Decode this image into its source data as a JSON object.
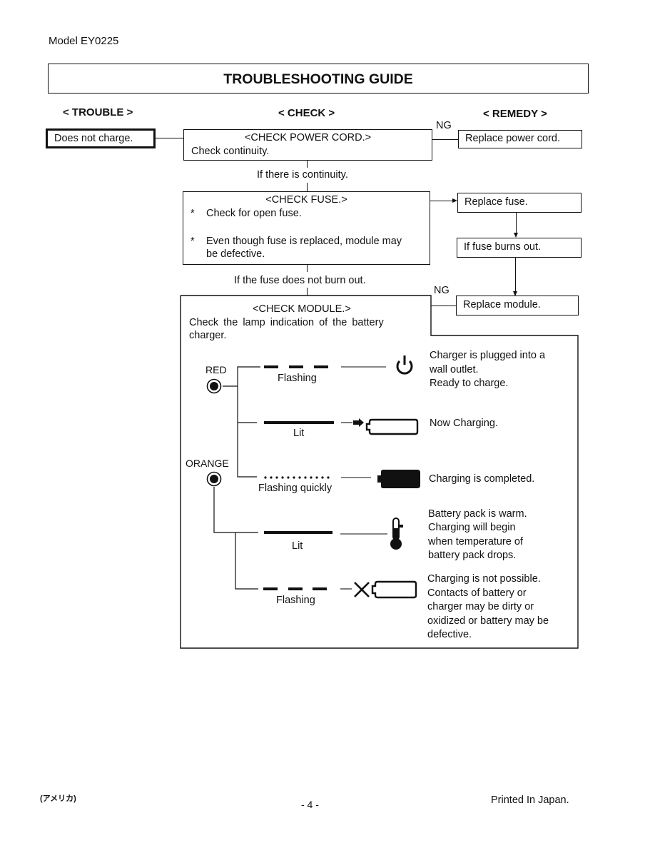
{
  "header": {
    "model": "Model EY0225",
    "title": "TROUBLESHOOTING GUIDE"
  },
  "columns": {
    "trouble": "< TROUBLE >",
    "check": "< CHECK >",
    "remedy": "< REMEDY >"
  },
  "trouble": {
    "label": "Does not charge."
  },
  "checks": {
    "power_cord": {
      "title": "<CHECK POWER CORD.>",
      "body": "Check continuity.",
      "ng_label": "NG",
      "next_label": "If there is continuity."
    },
    "fuse": {
      "title": "<CHECK FUSE.>",
      "bullets": [
        {
          "marker": "*",
          "text": "Check for open fuse."
        },
        {
          "marker": "*",
          "text_line1": "Even though fuse is replaced, module may",
          "text_line2": "be defective."
        }
      ],
      "next_label": "If the fuse does not burn out."
    },
    "module": {
      "title": "<CHECK MODULE.>",
      "body_line1": "Check  the  lamp  indication  of  the  battery",
      "body_line2": "charger.",
      "ng_label": "NG"
    }
  },
  "remedies": {
    "replace_power_cord": "Replace power cord.",
    "replace_fuse": "Replace fuse.",
    "if_fuse_burns_out": "If fuse burns out.",
    "replace_module": "Replace module."
  },
  "lamps": {
    "red_label": "RED",
    "orange_label": "ORANGE",
    "indications": [
      {
        "lamp": "RED",
        "pattern": "Flashing",
        "icon": "power-icon",
        "lines": [
          "Charger is plugged into a",
          "wall outlet.",
          "Ready to charge."
        ]
      },
      {
        "lamp": "RED",
        "pattern": "Lit",
        "icon": "battery-charging-icon",
        "lines": [
          "Now Charging."
        ]
      },
      {
        "lamp": "ORANGE",
        "pattern": "Flashing quickly",
        "icon": "battery-full-icon",
        "lines": [
          "Charging is completed."
        ]
      },
      {
        "lamp": "ORANGE",
        "pattern": "Lit",
        "icon": "thermometer-icon",
        "lines": [
          "Battery pack is warm.",
          "Charging will begin",
          "when temperature of",
          "battery pack drops."
        ]
      },
      {
        "lamp": "ORANGE",
        "pattern": "Flashing",
        "icon": "battery-error-icon",
        "lines": [
          "Charging is not possible.",
          "Contacts of battery or",
          "charger may be dirty or",
          "oxidized or battery may be",
          "defective."
        ]
      }
    ]
  },
  "footer": {
    "region": "(アメリカ)",
    "page": "- 4 -",
    "printed": "Printed In Japan."
  }
}
